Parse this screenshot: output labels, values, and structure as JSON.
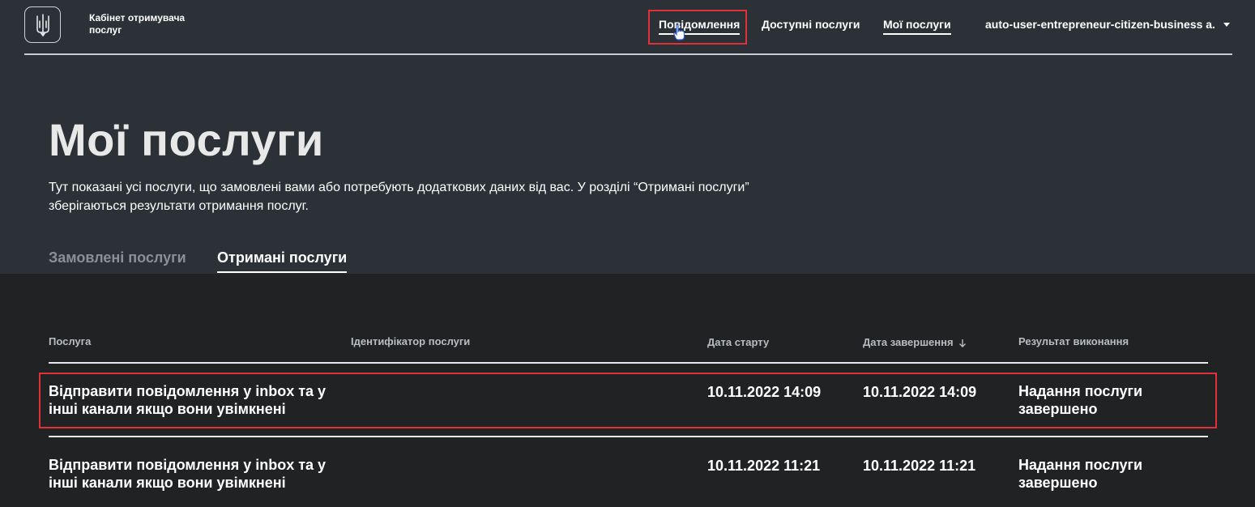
{
  "header": {
    "brand": "Кабінет отримувача послуг",
    "nav": {
      "notifications": "Повідомлення",
      "available": "Доступні послуги",
      "mine": "Мої послуги"
    },
    "user": "auto-user-entrepreneur-citizen-business a."
  },
  "main": {
    "title": "Мої послуги",
    "description": "Тут показані усі послуги, що замовлені вами або потребують додаткових даних від вас. У розділі “Отримані послуги” зберігаються результати отримання послуг.",
    "tabs": [
      "Замовлені послуги",
      "Отримані послуги"
    ]
  },
  "table": {
    "headers": [
      "Послуга",
      "Ідентифікатор послуги",
      "Дата старту",
      "Дата завершення",
      "Результат виконання"
    ],
    "rows": [
      {
        "service": "Відправити повідомлення у inbox та у інші канали якщо вони увімкнені",
        "id": "",
        "start": "10.11.2022 14:09",
        "end": "10.11.2022 14:09",
        "result": "Надання послуги завершено"
      },
      {
        "service": "Відправити повідомлення у inbox та у інші канали якщо вони увімкнені",
        "id": "",
        "start": "10.11.2022 11:21",
        "end": "10.11.2022 11:21",
        "result": "Надання послуги завершено"
      }
    ]
  },
  "colors": {
    "hero_bg": "#2b3137",
    "page_bg": "#202224",
    "highlight": "#e0313a"
  },
  "icons": {
    "logo": "trident-icon",
    "user_menu": "caret-down-icon",
    "sort": "arrow-down-icon",
    "cursor": "hand-pointer-icon"
  }
}
